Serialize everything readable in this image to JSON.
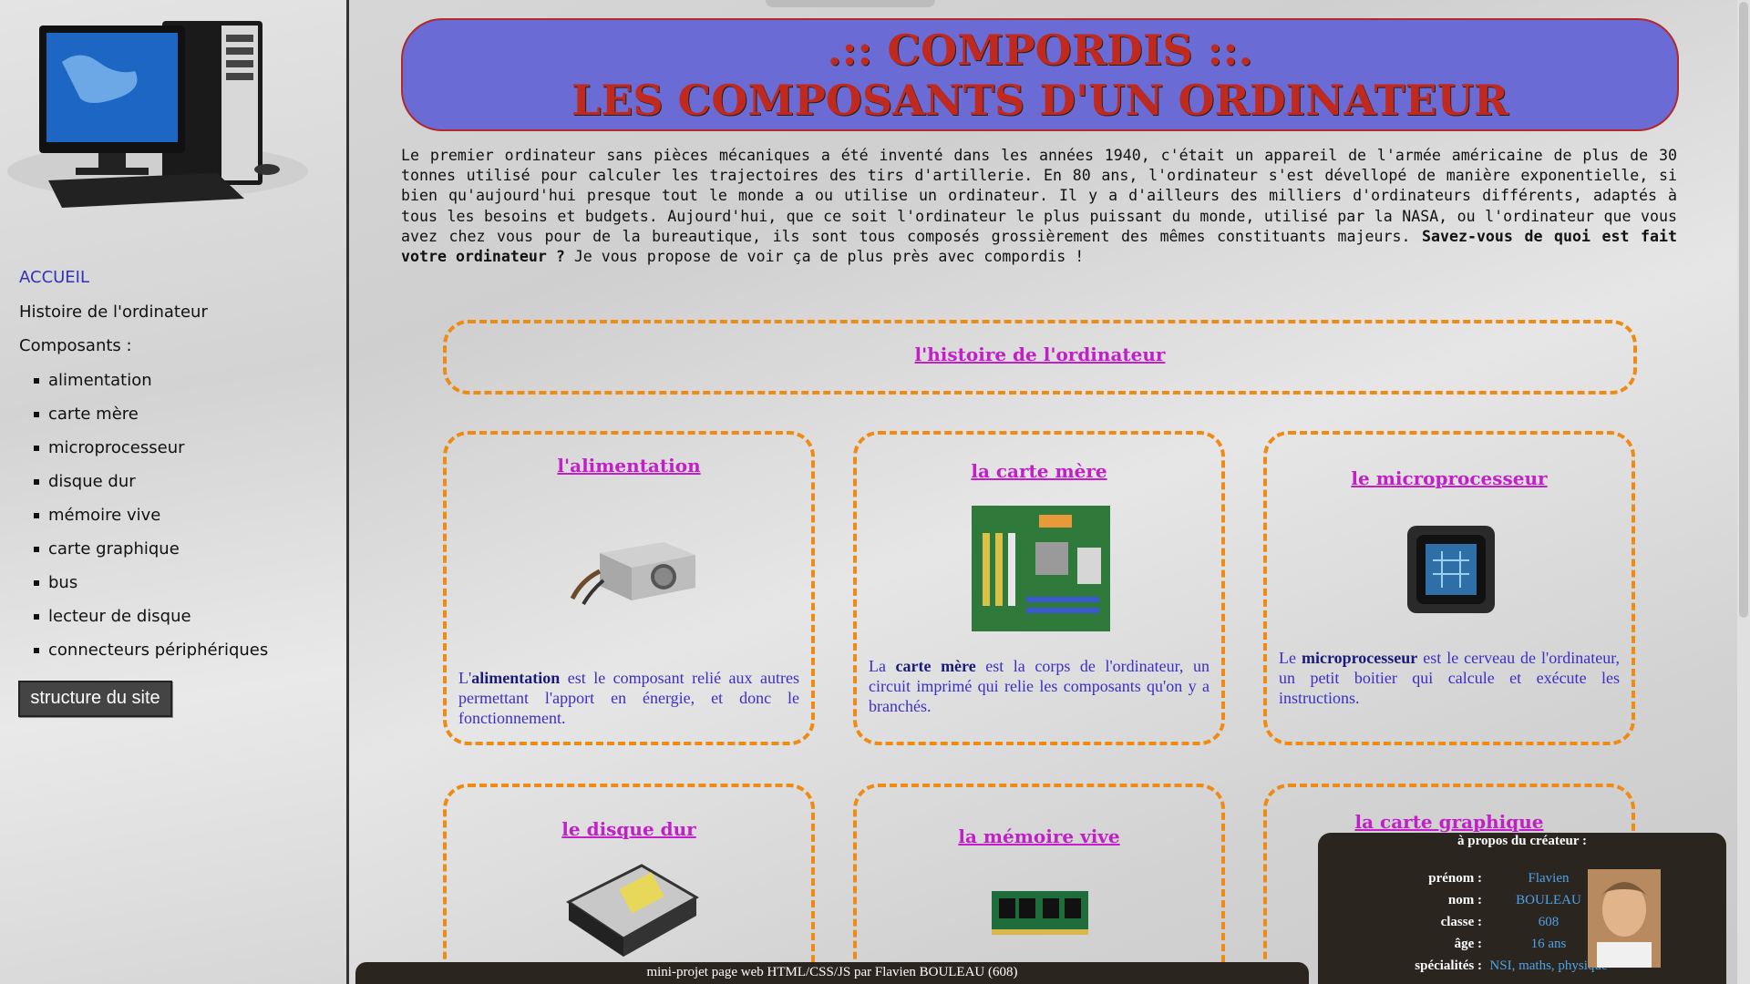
{
  "sidebar": {
    "nav_home": "ACCUEIL",
    "nav_history": "Histoire de l'ordinateur",
    "nav_components": "Composants :",
    "components": [
      "alimentation",
      "carte mère",
      "microprocesseur",
      "disque dur",
      "mémoire vive",
      "carte graphique",
      "bus",
      "lecteur de disque",
      "connecteurs périphériques"
    ],
    "structure_button": "structure du site"
  },
  "banner": {
    "line1": ".:: COMPORDIS ::.",
    "line2": "LES COMPOSANTS D'UN ORDINATEUR"
  },
  "intro": {
    "text": "Le premier ordinateur sans pièces mécaniques a été inventé dans les années 1940, c'était un appareil de l'armée américaine de plus de 30 tonnes utilisé pour calculer les trajectoires des tirs d'artillerie. En 80 ans, l'ordinateur s'est dévellopé de manière exponentielle, si bien qu'aujourd'hui presque tout le monde a ou utilise un ordinateur. Il y a d'ailleurs des milliers d'ordinateurs différents, adaptés à tous les besoins et budgets. Aujourd'hui, que ce soit l'ordinateur le plus puissant du monde, utilisé par la NASA, ou l'ordinateur que vous avez chez vous pour de la bureautique, ils sont tous composés grossièrement des mêmes constituants majeurs. ",
    "bold": "Savez-vous de quoi est fait votre ordinateur ?",
    "tail": " Je vous propose de voir ça de plus près avec compordis !"
  },
  "cards": {
    "history": "l'histoire de l'ordinateur",
    "power": {
      "title": "l'alimentation",
      "pre": "L'",
      "term": "alimentation",
      "post": " est le composant relié aux autres permettant l'apport en énergie, et donc le fonctionnement."
    },
    "motherboard": {
      "title": "la carte mère",
      "pre": "La ",
      "term": "carte mère",
      "post": " est la corps de l'ordinateur, un circuit imprimé qui relie les composants qu'on y a branchés."
    },
    "cpu": {
      "title": "le microprocesseur",
      "pre": "Le ",
      "term": "microprocesseur",
      "post": " est le cerveau de l'ordinateur, un petit boitier qui calcule et exécute les instructions."
    },
    "hdd": {
      "title": "le disque dur"
    },
    "ram": {
      "title": "la mémoire vive"
    },
    "gpu": {
      "title": "la carte graphique"
    }
  },
  "footer": "mini-projet page web HTML/CSS/JS par Flavien BOULEAU (608)",
  "about": {
    "heading": "à propos du créateur :",
    "rows": [
      {
        "k": "prénom :",
        "v": "Flavien"
      },
      {
        "k": "nom :",
        "v": "BOULEAU"
      },
      {
        "k": "classe :",
        "v": "608"
      },
      {
        "k": "âge :",
        "v": "16 ans"
      },
      {
        "k": "spécialités :",
        "v": "NSI, maths, physique"
      }
    ]
  },
  "colors": {
    "accent": "#ef8a14",
    "banner_bg": "#6b6bd6",
    "banner_text": "#c0291e",
    "link": "#c21fc8",
    "desc": "#3b2fc6"
  }
}
